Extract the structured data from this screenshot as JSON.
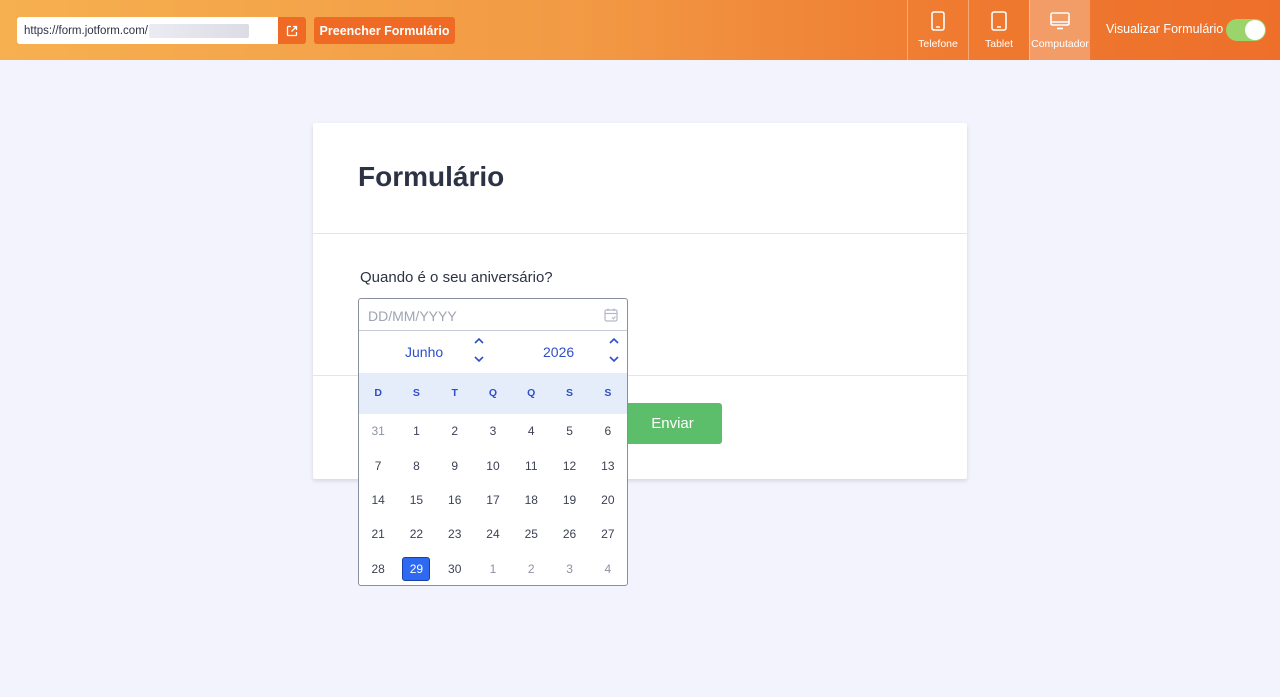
{
  "topbar": {
    "url_text": "https://form.jotform.com/",
    "fill_button_label": "Preencher Formulário",
    "devices": [
      {
        "label": "Telefone",
        "icon": "phone-icon",
        "active": false
      },
      {
        "label": "Tablet",
        "icon": "tablet-icon",
        "active": false
      },
      {
        "label": "Computador",
        "icon": "desktop-icon",
        "active": true
      }
    ],
    "preview_label": "Visualizar Formulário",
    "preview_toggle_on": true
  },
  "form": {
    "title": "Formulário",
    "question": "Quando é o seu aniversário?",
    "date_placeholder": "DD/MM/YYYY",
    "submit_label": "Enviar"
  },
  "calendar": {
    "month": "Junho",
    "year": "2026",
    "weekdays": [
      "D",
      "S",
      "T",
      "Q",
      "Q",
      "S",
      "S"
    ],
    "weeks": [
      [
        "31",
        "1",
        "2",
        "3",
        "4",
        "5",
        "6"
      ],
      [
        "7",
        "8",
        "9",
        "10",
        "11",
        "12",
        "13"
      ],
      [
        "14",
        "15",
        "16",
        "17",
        "18",
        "19",
        "20"
      ],
      [
        "21",
        "22",
        "23",
        "24",
        "25",
        "26",
        "27"
      ],
      [
        "28",
        "29",
        "30",
        "1",
        "2",
        "3",
        "4"
      ]
    ],
    "selected_day": "29"
  },
  "colors": {
    "accent_orange": "#ee6a25",
    "calendar_blue": "#2e4fc9",
    "selected_blue": "#2e69f2",
    "submit_green": "#5cbd6a",
    "toggle_green": "#9bd46a"
  }
}
